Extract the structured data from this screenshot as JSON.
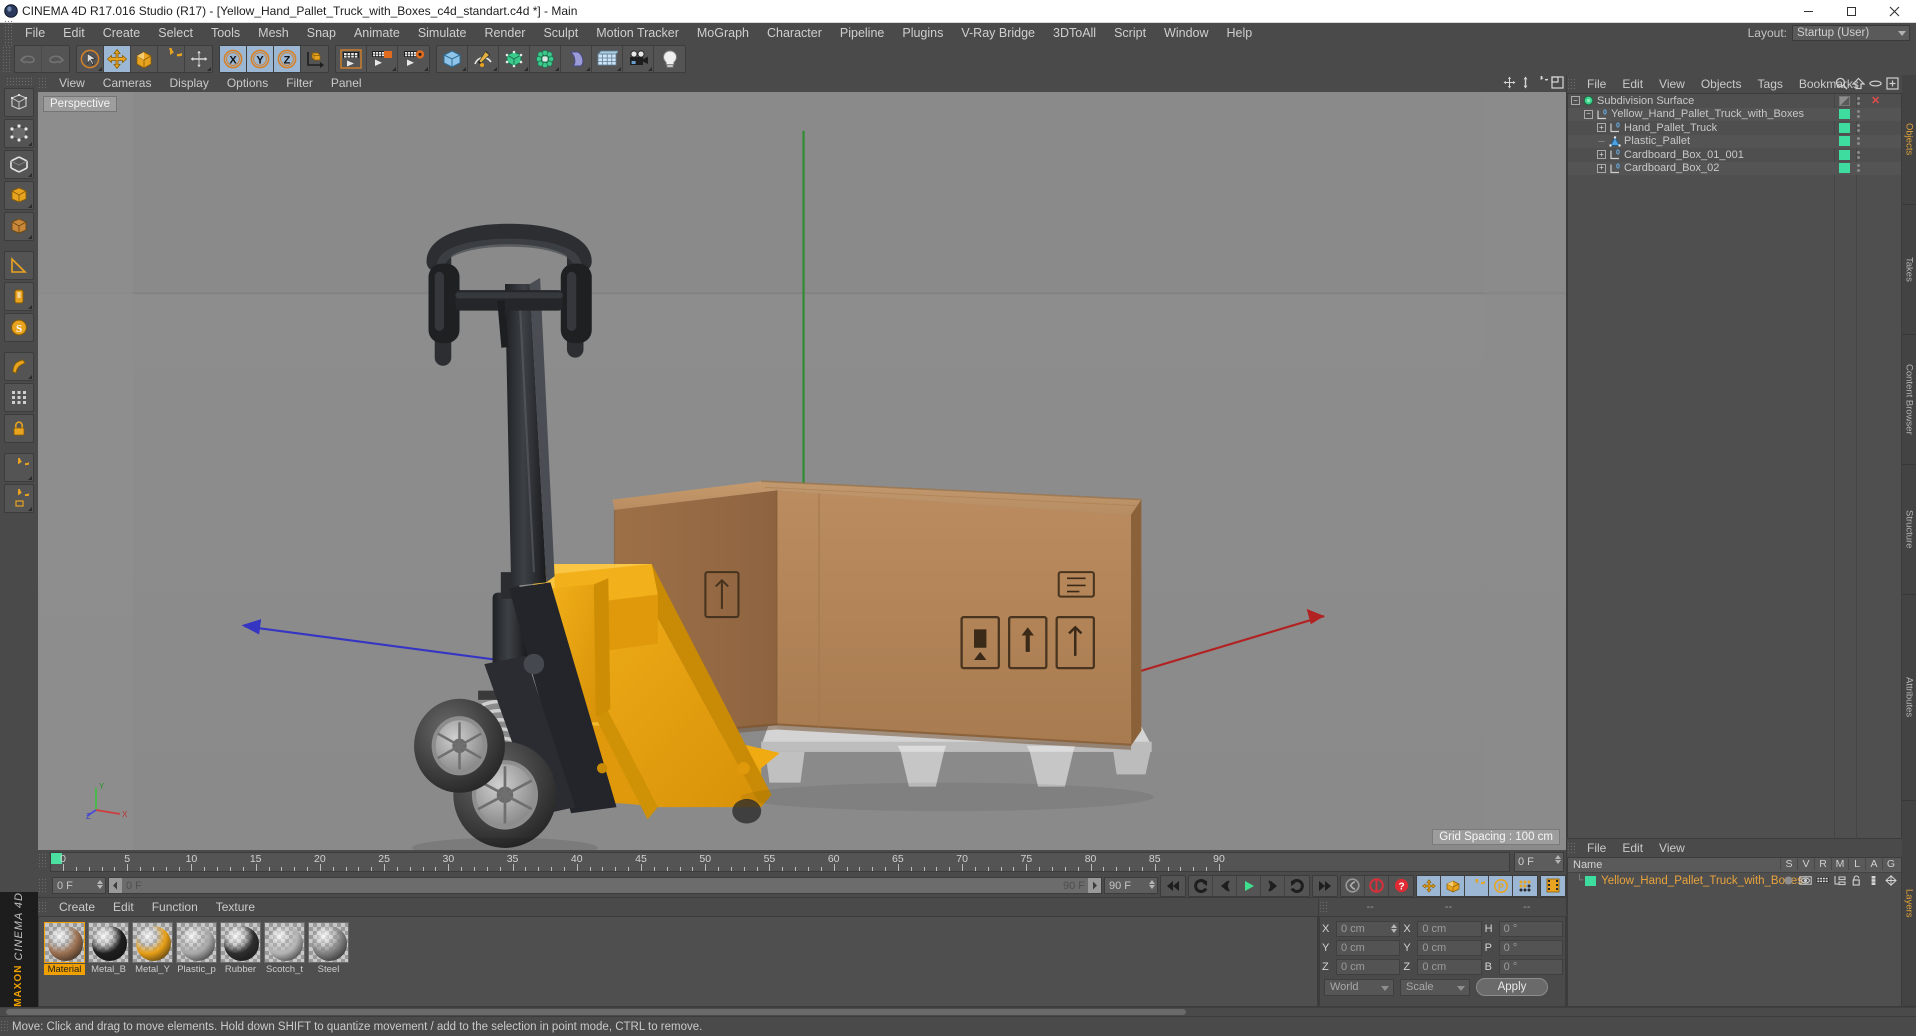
{
  "window": {
    "title": "CINEMA 4D R17.016 Studio (R17) - [Yellow_Hand_Pallet_Truck_with_Boxes_c4d_standart.c4d *] - Main",
    "minimize": "─",
    "maximize": "☐",
    "close": "✕"
  },
  "menubar": {
    "items": [
      "File",
      "Edit",
      "Create",
      "Select",
      "Tools",
      "Mesh",
      "Snap",
      "Animate",
      "Simulate",
      "Render",
      "Sculpt",
      "Motion Tracker",
      "MoGraph",
      "Character",
      "Pipeline",
      "Plugins",
      "V-Ray Bridge",
      "3DToAll",
      "Script",
      "Window",
      "Help"
    ],
    "layout_label": "Layout:",
    "layout_value": "Startup (User)"
  },
  "viewport": {
    "menus": [
      "View",
      "Cameras",
      "Display",
      "Options",
      "Filter",
      "Panel"
    ],
    "perspective_label": "Perspective",
    "grid_spacing": "Grid Spacing : 100 cm",
    "axis_labels": {
      "y": "Y",
      "x": "X",
      "z": "Z"
    }
  },
  "timeline": {
    "ticks": [
      0,
      5,
      10,
      15,
      20,
      25,
      30,
      35,
      40,
      45,
      50,
      55,
      60,
      65,
      70,
      75,
      80,
      85,
      90
    ],
    "current_frame_left": "0 F",
    "slider_start": "0 F",
    "slider_end": "90 F",
    "end_frame": "90 F",
    "preview_end": "0 F"
  },
  "material_manager": {
    "menus": [
      "Create",
      "Edit",
      "Function",
      "Texture"
    ],
    "materials": [
      {
        "name": "Material",
        "color": "#9b7050",
        "selected": true
      },
      {
        "name": "Metal_B",
        "color": "#1f1f1f",
        "selected": false
      },
      {
        "name": "Metal_Y",
        "color": "#e8a017",
        "selected": false
      },
      {
        "name": "Plastic_p",
        "color": "#a8a8a8",
        "selected": false
      },
      {
        "name": "Rubber",
        "color": "#2e2e2e",
        "selected": false
      },
      {
        "name": "Scotch_t",
        "color": "#b4b4b4",
        "selected": false
      },
      {
        "name": "Steel",
        "color": "#7f7f7f",
        "selected": false
      }
    ]
  },
  "coordinates": {
    "header_dashes": [
      "--",
      "--",
      "--"
    ],
    "rows": [
      {
        "l1": "X",
        "v1": "0 cm",
        "l2": "X",
        "v2": "0 cm",
        "l3": "H",
        "v3": "0 °"
      },
      {
        "l1": "Y",
        "v1": "0 cm",
        "l2": "Y",
        "v2": "0 cm",
        "l3": "P",
        "v3": "0 °"
      },
      {
        "l1": "Z",
        "v1": "0 cm",
        "l2": "Z",
        "v2": "0 cm",
        "l3": "B",
        "v3": "0 °"
      }
    ],
    "system": "World",
    "mode": "Scale",
    "apply": "Apply"
  },
  "object_manager": {
    "menus": [
      "File",
      "Edit",
      "View",
      "Objects",
      "Tags",
      "Bookmarks"
    ],
    "items": [
      {
        "name": "Subdivision Surface",
        "indent": 0,
        "icon": "subdivision-surface-icon",
        "expander": "minus",
        "box": "gray",
        "xred": true,
        "alt": false
      },
      {
        "name": "Yellow_Hand_Pallet_Truck_with_Boxes",
        "indent": 1,
        "icon": "null-object-icon",
        "expander": "minus",
        "box": "green",
        "xred": false,
        "alt": true
      },
      {
        "name": "Hand_Pallet_Truck",
        "indent": 2,
        "icon": "null-object-icon",
        "expander": "plus",
        "box": "green",
        "xred": false,
        "alt": false
      },
      {
        "name": "Plastic_Pallet",
        "indent": 2,
        "icon": "polygon-object-icon",
        "expander": "none",
        "box": "green",
        "xred": false,
        "alt": true
      },
      {
        "name": "Cardboard_Box_01_001",
        "indent": 2,
        "icon": "null-object-icon",
        "expander": "plus",
        "box": "green",
        "xred": false,
        "alt": false
      },
      {
        "name": "Cardboard_Box_02",
        "indent": 2,
        "icon": "null-object-icon",
        "expander": "plus",
        "box": "green",
        "xred": false,
        "alt": true
      }
    ],
    "tag_row_index": 3
  },
  "layer_manager": {
    "menus": [
      "File",
      "Edit",
      "View"
    ],
    "name_header": "Name",
    "columns": [
      "S",
      "V",
      "R",
      "M",
      "L",
      "A",
      "G"
    ],
    "rows": [
      {
        "name": "Yellow_Hand_Pallet_Truck_with_Boxes",
        "color": "#3fdca0"
      }
    ]
  },
  "vertical_tabs_right": [
    "Objects",
    "Takes",
    "Content Browser",
    "Structure"
  ],
  "vertical_tabs_right2": [
    "Attributes",
    "Layers"
  ],
  "statusbar": {
    "text": "Move: Click and drag to move elements. Hold down SHIFT to quantize movement / add to the selection in point mode, CTRL to remove."
  },
  "brand": {
    "maxon": "MAXON",
    "c4d": "CINEMA 4D"
  },
  "colors": {
    "accent_orange": "#f0a000",
    "active_blue": "#9bb7d4",
    "green_box": "#3fdca0",
    "panel_bg": "#4a4a4a",
    "viewport_bg": "#8a8a8a"
  }
}
